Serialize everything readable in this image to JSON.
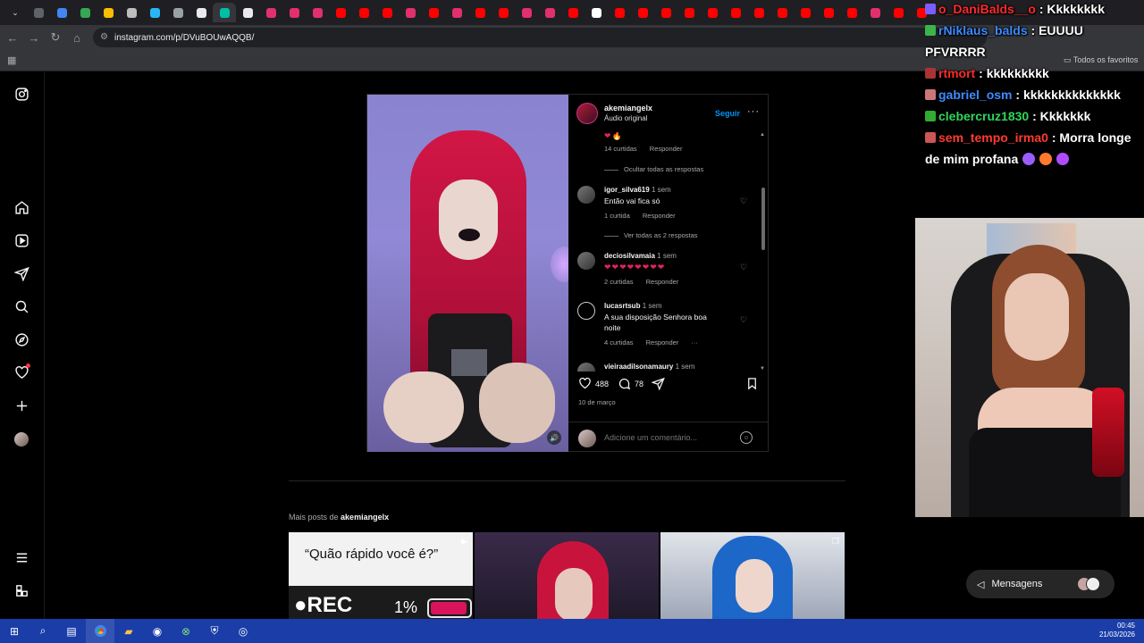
{
  "browser": {
    "url": "instagram.com/p/DVuBOUwAQQB/",
    "favorites_label": "Todos os favoritos",
    "tab_colors": [
      "#5f6368",
      "#4285f4",
      "#34a853",
      "#fbbc05",
      "#bdbdbd",
      "#29b6f6",
      "#9aa0a6",
      "#e8eaed",
      "#00bfa5",
      "#e8eaed",
      "#e1306c",
      "#e1306c",
      "#e1306c",
      "#ff0000",
      "#ff0000",
      "#ff0000",
      "#e1306c",
      "#ff0000",
      "#e1306c",
      "#ff0000",
      "#ff0000",
      "#e1306c",
      "#e1306c",
      "#ff0000",
      "#ffffff",
      "#ff0000",
      "#ff0000",
      "#ff0000",
      "#ff0000",
      "#ff0000",
      "#ff0000",
      "#ff0000",
      "#ff0000",
      "#ff0000",
      "#ff0000",
      "#ff0000",
      "#e1306c",
      "#ff0000",
      "#ff0000"
    ]
  },
  "post": {
    "username": "akemiangelx",
    "audio": "Áudio original",
    "follow_label": "Seguir",
    "more_label": "···",
    "comments": [
      {
        "text": "❤🔥",
        "likes": "14 curtidas",
        "reply": "Responder"
      },
      {
        "hide_replies": "Ocultar todas as respostas"
      },
      {
        "user": "igor_silva619",
        "time": "1 sem",
        "text": "Então vai fica só",
        "likes": "1 curtida",
        "reply": "Responder"
      },
      {
        "see_replies": "Ver todas as 2 respostas"
      },
      {
        "user": "deciosilvamaia",
        "time": "1 sem",
        "text": "❤❤❤❤❤❤❤❤",
        "likes": "2 curtidas",
        "reply": "Responder"
      },
      {
        "user": "lucasrtsub",
        "time": "1 sem",
        "text": "A sua disposição Senhora boa noite",
        "likes": "4 curtidas",
        "reply": "Responder",
        "more": "···"
      },
      {
        "user": "vieiraadilsonamaury",
        "time": "1 sem"
      }
    ],
    "like_count": "488",
    "comment_count": "78",
    "date": "10 de março",
    "add_comment_placeholder": "Adicione um comentário..."
  },
  "more_posts": {
    "prefix": "Mais posts de",
    "username": "akemiangelx",
    "tile1_question": "“Quão rápido você é?”",
    "tile1_rec": "●REC",
    "tile1_percent": "1%"
  },
  "messages_label": "Mensagens",
  "chat": [
    {
      "nick": "o_DaniBalds__o",
      "nick_color": "#ff2a2a",
      "sep": " : ",
      "msg": "Kkkkkkkk"
    },
    {
      "nick": "rNiklaus_balds",
      "nick_color": "#3d8bff",
      "sep": " : ",
      "msg": "EUUUU PFVRRRR"
    },
    {
      "nick": "rtmort",
      "nick_color": "#ff2a2a",
      "sep": " : ",
      "msg": "kkkkkkkkk"
    },
    {
      "nick": "gabriel_osm",
      "nick_color": "#3d8bff",
      "sep": " : ",
      "msg": "kkkkkkkkkkkkkk"
    },
    {
      "nick": "clebercruz1830",
      "nick_color": "#2fd65a",
      "sep": " : ",
      "msg": "Kkkkkkk"
    },
    {
      "nick": "sem_tempo_irma0",
      "nick_color": "#ff3b2f",
      "sep": " : ",
      "msg": "Morra longe de mim profana"
    }
  ],
  "clock": {
    "time": "00:45",
    "date": "21/03/2026"
  }
}
